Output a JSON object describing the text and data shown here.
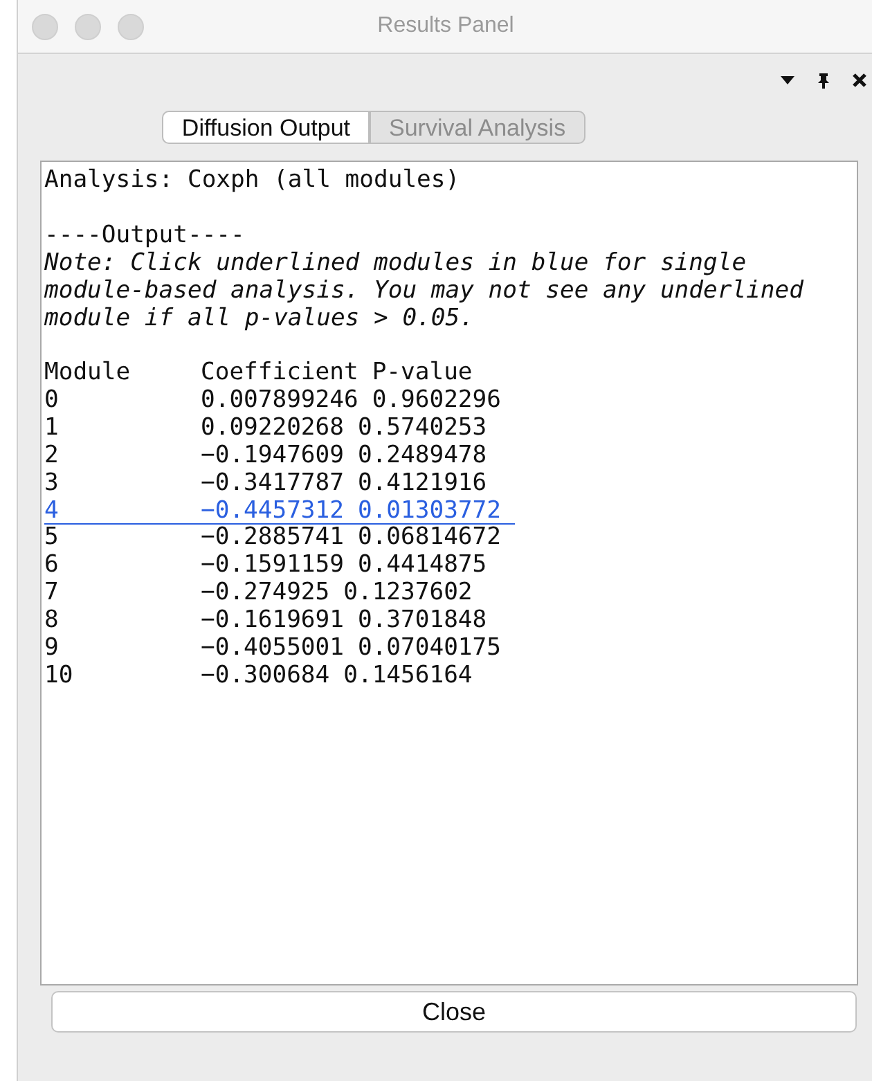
{
  "window": {
    "title": "Results Panel"
  },
  "panel_controls": [
    {
      "kind": "menu"
    },
    {
      "kind": "pin"
    },
    {
      "kind": "close"
    }
  ],
  "tabs": [
    {
      "label": "Diffusion Output",
      "selected": true
    },
    {
      "label": "Survival Analysis",
      "selected": false
    }
  ],
  "output": {
    "analysis": "Analysis: Coxph (all modules)",
    "heading": "----Output----",
    "note": "Note: Click underlined modules in blue for single module-based analysis. You may not see any underlined module if all p-values > 0.05.",
    "columns": [
      "Module",
      "Coefficient",
      "P-value"
    ],
    "rows": [
      {
        "module": "0",
        "coefficient": "0.007899246",
        "p_value": "0.9602296",
        "link": false
      },
      {
        "module": "1",
        "coefficient": "0.09220268",
        "p_value": "0.5740253",
        "link": false
      },
      {
        "module": "2",
        "coefficient": "−0.1947609",
        "p_value": "0.2489478",
        "link": false
      },
      {
        "module": "3",
        "coefficient": "−0.3417787",
        "p_value": "0.4121916",
        "link": false
      },
      {
        "module": "4",
        "coefficient": "−0.4457312",
        "p_value": "0.01303772",
        "link": true
      },
      {
        "module": "5",
        "coefficient": "−0.2885741",
        "p_value": "0.06814672",
        "link": false
      },
      {
        "module": "6",
        "coefficient": "−0.1591159",
        "p_value": "0.4414875",
        "link": false
      },
      {
        "module": "7",
        "coefficient": "−0.274925",
        "p_value": "0.1237602",
        "link": false
      },
      {
        "module": "8",
        "coefficient": "−0.1619691",
        "p_value": "0.3701848",
        "link": false
      },
      {
        "module": "9",
        "coefficient": "−0.4055001",
        "p_value": "0.07040175",
        "link": false
      },
      {
        "module": "10",
        "coefficient": "−0.300684",
        "p_value": "0.1456164",
        "link": false
      }
    ]
  },
  "buttons": [
    "Close"
  ]
}
